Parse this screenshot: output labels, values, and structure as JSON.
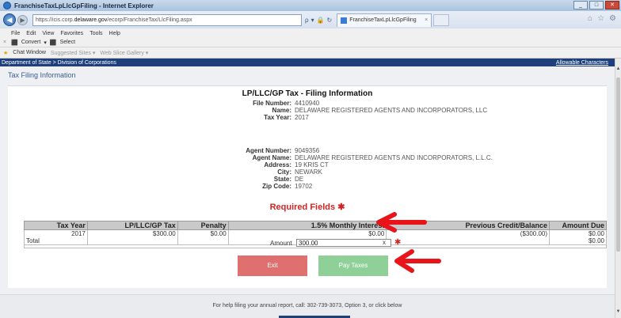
{
  "window": {
    "title": "FranchiseTaxLpLlcGpFiling - Internet Explorer",
    "controls": [
      "_",
      "□",
      "✕"
    ]
  },
  "address": {
    "url_prefix": "https://icis.corp.",
    "url_host": "delaware.gov",
    "url_path": "/ecorp/FranchiseTax/LlcFiling.aspx",
    "tab_title": "FranchiseTaxLpLlcGpFiling",
    "tab_close": "×",
    "back_glyph": "◀",
    "forward_glyph": "▶",
    "search_glyph": "ρ",
    "dropdown_glyph": "▾",
    "lock_glyph": "🔒",
    "refresh_glyph": "↻",
    "right_icons": [
      "⌂",
      "☆",
      "⚙"
    ]
  },
  "menu": {
    "items": [
      "File",
      "Edit",
      "View",
      "Favorites",
      "Tools",
      "Help"
    ]
  },
  "convert_bar": {
    "close_glyph": "×",
    "pdf_glyph": "⬛",
    "convert_label": "Convert",
    "convert_arrow": "▾",
    "select_label": "Select"
  },
  "favorites_bar": {
    "star_glyph": "★",
    "chat_label": "Chat Window",
    "suggested_label": "Suggested Sites ▾",
    "slice_label": "Web Slice Gallery ▾"
  },
  "page": {
    "breadcrumb": "Department of State > Division of Corporations",
    "allowable": "Allowable Characters",
    "section_title": "Tax Filing Information",
    "header_title": "LP/LLC/GP Tax - Filing Information",
    "filing": [
      {
        "label": "File Number:",
        "value": "4410940"
      },
      {
        "label": "Name:",
        "value": "DELAWARE REGISTERED AGENTS AND INCORPORATORS, LLC"
      },
      {
        "label": "Tax Year:",
        "value": "2017"
      }
    ],
    "agent": [
      {
        "label": "Agent Number:",
        "value": "9049356"
      },
      {
        "label": "Agent Name:",
        "value": "DELAWARE REGISTERED AGENTS AND INCORPORATORS, L.L.C."
      },
      {
        "label": "Address:",
        "value": "19 KRIS CT"
      },
      {
        "label": "City:",
        "value": "NEWARK"
      },
      {
        "label": "State:",
        "value": "DE"
      },
      {
        "label": "Zip Code:",
        "value": "19702"
      }
    ],
    "required_label": "Required Fields",
    "required_star": "✱",
    "table": {
      "headers": [
        "Tax Year",
        "LP/LLC/GP Tax",
        "Penalty",
        "1.5% Monthly Interest",
        "Previous Credit/Balance",
        "Amount Due"
      ],
      "row": [
        "2017",
        "$300.00",
        "$0.00",
        "$0.00",
        "($300.00)",
        "$0.00"
      ],
      "total_label": "Total",
      "total_due": "$0.00"
    },
    "amount_label": "Amount",
    "amount_value": "300.00",
    "amount_clear": "x",
    "amount_star": "✱",
    "exit_label": "Exit",
    "pay_label": "Pay Taxes",
    "footer_text": "For help filing your annual report, call: 302-739-3073, Option 3, or click below"
  },
  "colors": {
    "annotation_arrow": "#e8141a",
    "brand_bar": "#1f3f7a",
    "required": "#d62222"
  }
}
